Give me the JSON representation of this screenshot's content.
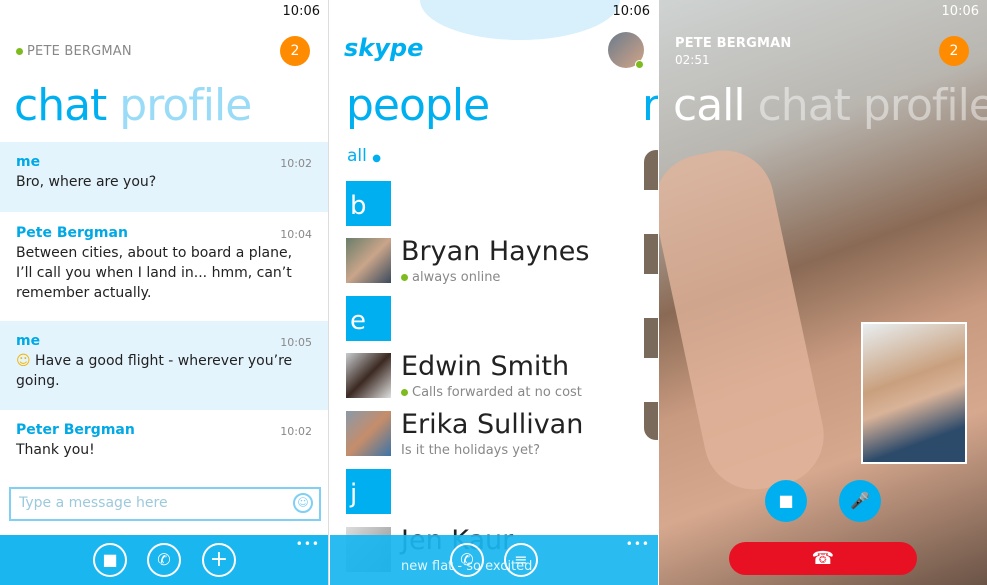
{
  "status": {
    "time": "10:06"
  },
  "chat": {
    "contact": "PETE BERGMAN",
    "badge": "2",
    "pivot_active": "chat",
    "pivot_next": "profile",
    "messages": [
      {
        "sender": "me",
        "time": "10:02",
        "text": "Bro, where are you?"
      },
      {
        "sender": "Pete Bergman",
        "time": "10:04",
        "text": "Between cities, about to board a plane, I’ll call you when I land in... hmm, can’t remember actually."
      },
      {
        "sender": "me",
        "time": "10:05",
        "text": "Have a good flight - wherever you’re going."
      },
      {
        "sender": "Peter Bergman",
        "time": "10:02",
        "text": "Thank you!"
      }
    ],
    "input_placeholder": "Type a message here",
    "more": "•••"
  },
  "people": {
    "logo": "skype",
    "title": "people",
    "peek": "r",
    "filter": "all",
    "groups": [
      {
        "letter": "b",
        "contacts": [
          {
            "name": "Bryan Haynes",
            "status": "always online",
            "online": true
          }
        ]
      },
      {
        "letter": "e",
        "contacts": [
          {
            "name": "Edwin Smith",
            "status": "Calls forwarded at no cost",
            "online": true
          },
          {
            "name": "Erika Sullivan",
            "status": "Is it the holidays yet?",
            "online": false
          }
        ]
      },
      {
        "letter": "j",
        "contacts": [
          {
            "name": "Jen Kaur",
            "status": "new flat - so excited",
            "online": false
          }
        ]
      }
    ],
    "more": "•••"
  },
  "call": {
    "contact": "PETE BERGMAN",
    "duration": "02:51",
    "badge": "2",
    "pivot_active": "call",
    "pivot_rest": "chat profile"
  },
  "colors": {
    "accent": "#00aff0",
    "badge": "#ff8c00",
    "online": "#7dbb1f",
    "end_call": "#e81123"
  }
}
